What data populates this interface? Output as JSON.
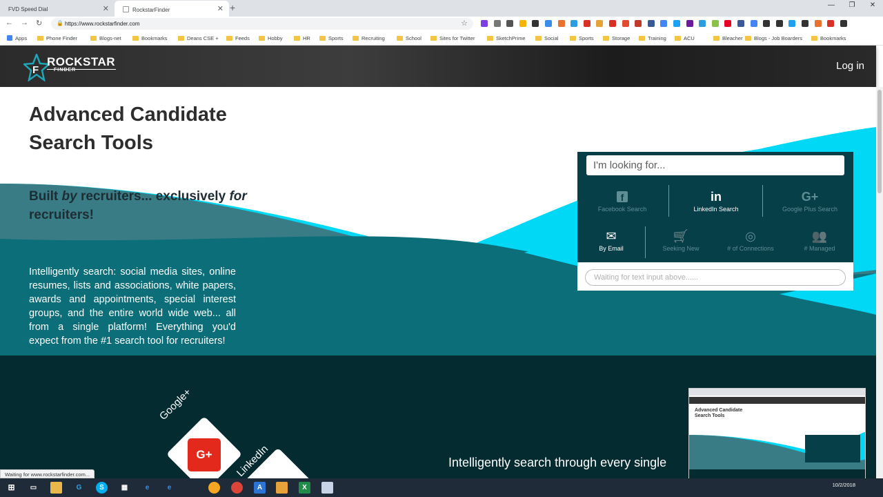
{
  "browser": {
    "tabs": [
      {
        "title": "FVD Speed Dial",
        "active": false
      },
      {
        "title": "RockstarFinder",
        "active": true
      }
    ],
    "url": "https://www.rockstarfinder.com",
    "bookmarks": [
      "Apps",
      "Phone Finder",
      "Blogs-net",
      "Bookmarks",
      "Deans CSE +",
      "Feeds",
      "Hobby",
      "HR",
      "Sports",
      "Recruiting",
      "School",
      "Sites for Twitter",
      "SketchPrime",
      "Social",
      "Sports",
      "Storage",
      "Training",
      "ACU",
      "Bleacher",
      "Blogs - Job Boarders",
      "Bookmarks"
    ],
    "status": "Waiting for www.rockstarfinder.com..."
  },
  "header": {
    "logo_main": "ROCKSTAR",
    "logo_sub": "FINDER",
    "login": "Log in"
  },
  "hero": {
    "title": "Advanced Candidate Search Tools",
    "tagline_1": "Built ",
    "tagline_by": "by",
    "tagline_2": " recruiters... exclusively ",
    "tagline_for": "for",
    "tagline_3": " recruiters!",
    "body": "Intelligently search: social media sites, online resumes, lists and associations, white papers, awards and appointments, special interest groups, and the entire world wide web... all from a single platform! Everything you'd expect from the #1 search tool for recruiters!"
  },
  "widget": {
    "search_placeholder": "I'm looking for...",
    "row1": [
      {
        "icon": "f",
        "label": "Facebook Search",
        "active": false
      },
      {
        "icon": "in",
        "label": "LinkedIn Search",
        "active": true
      },
      {
        "icon": "G+",
        "label": "Google Plus Search",
        "active": false
      }
    ],
    "row2": [
      {
        "icon": "✉",
        "label": "By Email",
        "active": true
      },
      {
        "icon": "🛒",
        "label": "Seeking New",
        "active": false
      },
      {
        "icon": "◎",
        "label": "# of Connections",
        "active": false
      },
      {
        "icon": "👥",
        "label": "# Managed",
        "active": false
      }
    ],
    "status_placeholder": "Waiting for text input above......"
  },
  "dark_section": {
    "googleplus_label": "Google+",
    "linkedin_label": "LinkedIn",
    "googleplus_icon": "G+",
    "text": "Intelligently search through every single"
  },
  "taskbar": {
    "time": "",
    "date": "10/2/2018"
  },
  "colors": {
    "teal_dark": "#073f48",
    "teal_mid": "#0a6e7a",
    "cyan": "#00d8f5",
    "google_red": "#e3291b"
  }
}
